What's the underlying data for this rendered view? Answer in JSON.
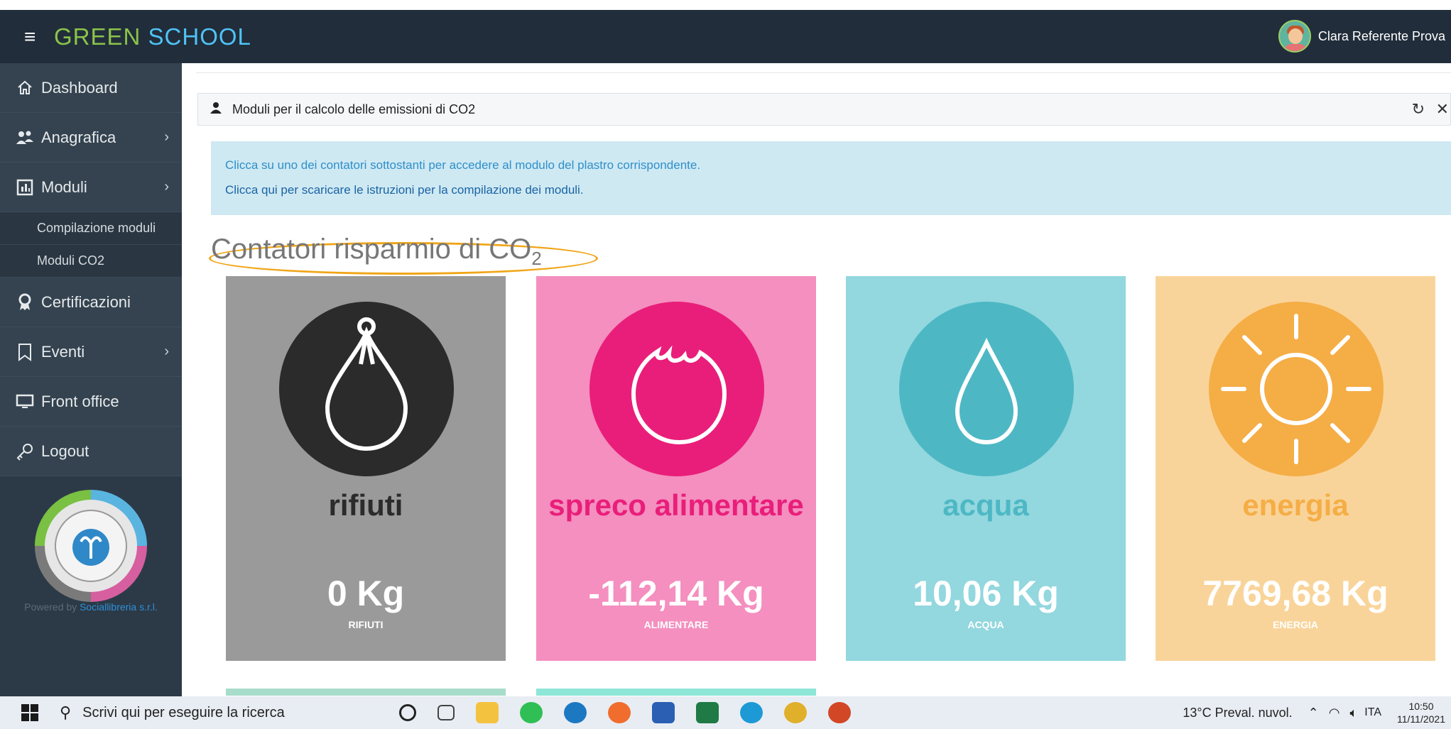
{
  "app": {
    "brand_part1": "GREEN",
    "brand_part2": "SCHOOL"
  },
  "user": {
    "name": "Clara Referente Prova"
  },
  "sidebar": {
    "items": [
      {
        "label": "Dashboard"
      },
      {
        "label": "Anagrafica"
      },
      {
        "label": "Moduli"
      },
      {
        "label": "Compilazione moduli"
      },
      {
        "label": "Moduli CO2"
      },
      {
        "label": "Certificazioni"
      },
      {
        "label": "Eventi"
      },
      {
        "label": "Front office"
      },
      {
        "label": "Logout"
      }
    ],
    "powered_prefix": "Powered by ",
    "powered_link": "Sociallibreria s.r.l."
  },
  "panel": {
    "title": "Moduli per il calcolo delle emissioni di CO2"
  },
  "alert": {
    "line1": "Clicca su uno dei contatori sottostanti per accedere al modulo del plastro corrispondente.",
    "line2": "Clicca qui per scaricare le istruzioni per la compilazione dei moduli."
  },
  "section": {
    "title_main": "Contatori risparmio di CO",
    "title_sub": "2"
  },
  "cards": [
    {
      "name": "rifiuti",
      "value": "0 Kg",
      "sub": "RIFIUTI",
      "bg": "#9a9a9a",
      "circle": "#2b2b2b",
      "name_color": "#2b2b2b"
    },
    {
      "name": "spreco alimentare",
      "value": "-112,14 Kg",
      "sub": "ALIMENTARE",
      "bg": "#f48fbf",
      "circle": "#e91e7a",
      "name_color": "#e91e7a"
    },
    {
      "name": "acqua",
      "value": "10,06 Kg",
      "sub": "ACQUA",
      "bg": "#93d7df",
      "circle": "#4db8c4",
      "name_color": "#4db8c4"
    },
    {
      "name": "energia",
      "value": "7769,68 Kg",
      "sub": "ENERGIA",
      "bg": "#f9d49a",
      "circle": "#f5ad45",
      "name_color": "#f5ad45"
    }
  ],
  "taskbar": {
    "search_placeholder": "Scrivi qui per eseguire la ricerca",
    "weather": "13°C  Preval. nuvol.",
    "lang": "ITA",
    "time": "10:50",
    "date": "11/11/2021"
  }
}
